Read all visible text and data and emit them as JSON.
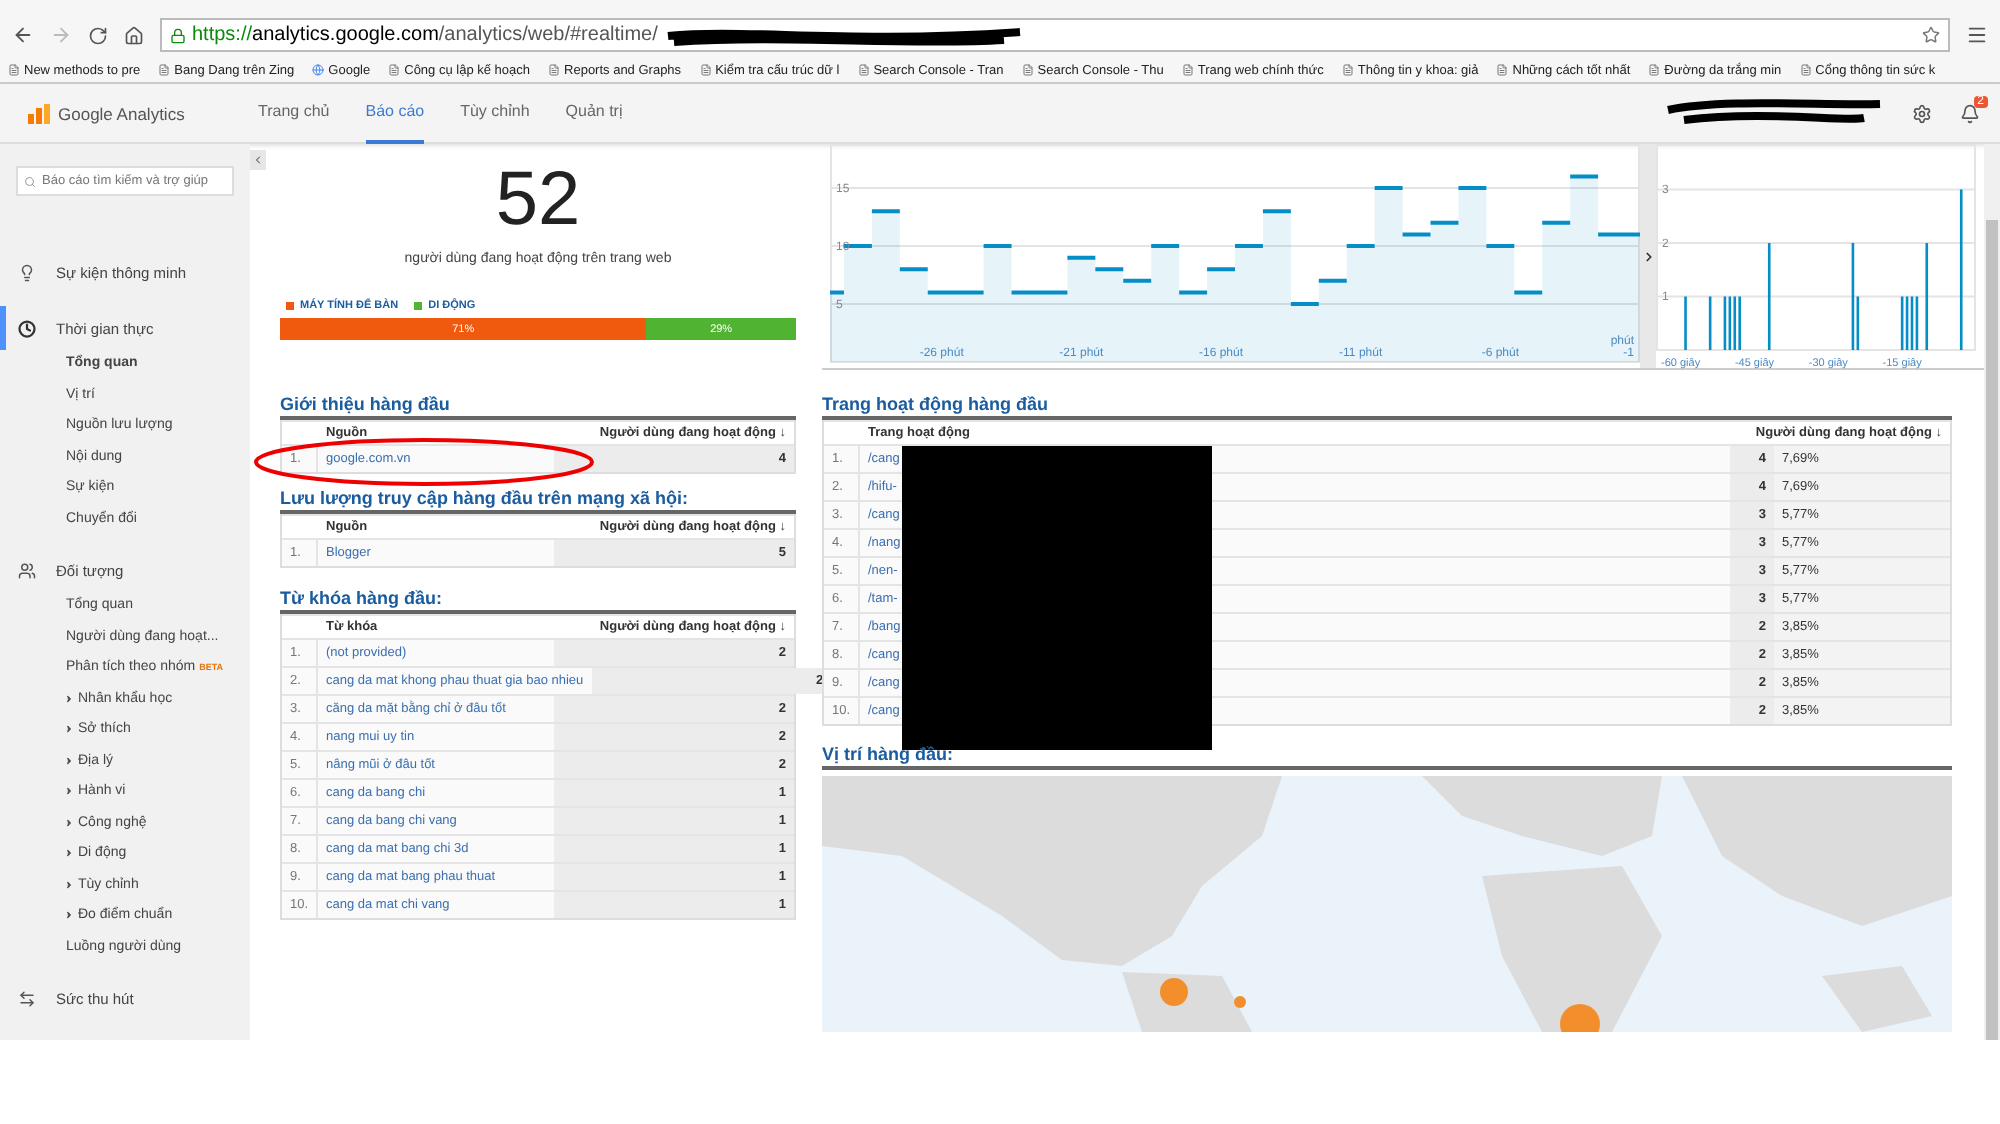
{
  "browser": {
    "url_scheme": "https://",
    "url_host": "analytics.google.com",
    "url_path": "/analytics/web/#realtime/",
    "bookmarks": [
      "New methods to pre",
      "Bang Dang trên Zing",
      "Google",
      "Công cụ lập kế hoạch",
      "Reports and Graphs",
      "Kiểm tra cấu trúc dữ l",
      "Search Console - Tran",
      "Search Console - Thu",
      "Trang web chính thức",
      "Thông tin y khoa: giả",
      "Những cách tốt nhất",
      "Đường da trắng min",
      "Cổng thông tin sức k"
    ]
  },
  "app": {
    "name": "Google Analytics",
    "notifications": "2",
    "nav": [
      {
        "label": "Trang chủ",
        "selected": false
      },
      {
        "label": "Báo cáo",
        "selected": true
      },
      {
        "label": "Tùy chỉnh",
        "selected": false
      },
      {
        "label": "Quản trị",
        "selected": false
      }
    ]
  },
  "sidebar": {
    "search": {
      "placeholder": "Báo cáo tìm kiếm và trợ giúp"
    },
    "sections": [
      {
        "kind": "insights",
        "label": "Sự kiện thông minh",
        "active": false
      },
      {
        "kind": "realtime",
        "label": "Thời gian thực",
        "active": true,
        "children": [
          {
            "label": "Tổng quan",
            "selected": true
          },
          {
            "label": "Vị trí",
            "selected": false
          },
          {
            "label": "Nguồn lưu lượng",
            "selected": false
          },
          {
            "label": "Nội dung",
            "selected": false
          },
          {
            "label": "Sự kiện",
            "selected": false
          },
          {
            "label": "Chuyển đổi",
            "selected": false
          }
        ]
      },
      {
        "kind": "audience",
        "label": "Đối tượng",
        "active": false,
        "children": [
          {
            "label": "Tổng quan",
            "selected": false,
            "expandable": false
          },
          {
            "label": "Người dùng đang hoạt...",
            "selected": false,
            "expandable": false
          },
          {
            "label": "Phân tích theo nhóm",
            "badge": "BETA",
            "selected": false,
            "expandable": false
          },
          {
            "label": "Nhân khẩu học",
            "selected": false,
            "expandable": true
          },
          {
            "label": "Sở thích",
            "selected": false,
            "expandable": true
          },
          {
            "label": "Địa lý",
            "selected": false,
            "expandable": true
          },
          {
            "label": "Hành vi",
            "selected": false,
            "expandable": true
          },
          {
            "label": "Công nghệ",
            "selected": false,
            "expandable": true
          },
          {
            "label": "Di động",
            "selected": false,
            "expandable": true
          },
          {
            "label": "Tùy chỉnh",
            "selected": false,
            "expandable": true
          },
          {
            "label": "Đo điểm chuẩn",
            "selected": false,
            "expandable": true
          },
          {
            "label": "Luồng người dùng",
            "selected": false,
            "expandable": false
          }
        ]
      },
      {
        "kind": "acquisition",
        "label": "Sức thu hút",
        "active": false
      }
    ]
  },
  "overview": {
    "count": "52",
    "caption": "người dùng đang hoạt động trên trang web",
    "devices": [
      {
        "label": "MÁY TÍNH ĐỂ BÀN",
        "share": "71%",
        "level": 0.71,
        "color": "#f05a0e"
      },
      {
        "label": "DI ĐỘNG",
        "share": "29%",
        "level": 0.29,
        "color": "#50b432"
      }
    ]
  },
  "per_minute": {
    "chart_data": {
      "type": "area",
      "x": [
        -30,
        -29,
        -28,
        -27,
        -26,
        -25,
        -24,
        -23,
        -22,
        -21,
        -20,
        -19,
        -18,
        -17,
        -16,
        -15,
        -14,
        -13,
        -12,
        -11,
        -10,
        -9,
        -8,
        -7,
        -6,
        -5,
        -4,
        -3,
        -2,
        -1
      ],
      "series": [
        {
          "color": "#058dc7",
          "values": [
            6,
            10,
            13,
            8,
            6,
            6,
            10,
            6,
            6,
            9,
            8,
            7,
            10,
            6,
            8,
            10,
            13,
            5,
            7,
            10,
            15,
            11,
            12,
            15,
            10,
            6,
            12,
            16,
            11,
            11
          ]
        }
      ],
      "xlim": [
        -30,
        -1
      ],
      "ylim": [
        0,
        18.8
      ],
      "yticks": [
        5,
        10,
        15
      ],
      "grid": true,
      "xticks": [
        {
          "value": -26,
          "label": "-26 phút"
        },
        {
          "value": -21,
          "label": "-21 phút"
        },
        {
          "value": -16,
          "label": "-16 phút"
        },
        {
          "value": -11,
          "label": "-11 phút"
        },
        {
          "value": -6,
          "label": "-6 phút"
        },
        {
          "value": -1,
          "label": "phút -1"
        }
      ]
    }
  },
  "per_second": {
    "chart_data": {
      "type": "bar",
      "x": [
        -60,
        -59,
        -58,
        -57,
        -56,
        -55,
        -54,
        -53,
        -52,
        -51,
        -50,
        -49,
        -48,
        -47,
        -46,
        -45,
        -44,
        -43,
        -42,
        -41,
        -40,
        -39,
        -38,
        -37,
        -36,
        -35,
        -34,
        -33,
        -32,
        -31,
        -30,
        -29,
        -28,
        -27,
        -26,
        -25,
        -24,
        -23,
        -22,
        -21,
        -20,
        -19,
        -18,
        -17,
        -16,
        -15,
        -14,
        -13,
        -12,
        -11,
        -10,
        -9,
        -8,
        -7,
        -6,
        -5,
        -4,
        -3,
        -2,
        -1
      ],
      "series": [
        {
          "color": "#058dc7",
          "values": [
            0,
            1,
            0,
            0,
            0,
            0,
            1,
            0,
            0,
            1,
            1,
            1,
            1,
            0,
            0,
            0,
            0,
            0,
            2,
            0,
            0,
            0,
            0,
            0,
            0,
            0,
            0,
            0,
            0,
            0,
            0,
            0,
            0,
            0,
            0,
            2,
            1,
            0,
            0,
            0,
            0,
            0,
            0,
            0,
            0,
            1,
            1,
            1,
            1,
            0,
            2,
            0,
            0,
            0,
            0,
            0,
            0,
            3,
            0,
            0
          ]
        }
      ],
      "xlim": [
        -65,
        0
      ],
      "ylim": [
        0,
        3.85
      ],
      "yticks": [
        1,
        2,
        3
      ],
      "grid": true,
      "xticks": [
        {
          "value": -60,
          "label": "-60 giây"
        },
        {
          "value": -45,
          "label": "-45 giây"
        },
        {
          "value": -30,
          "label": "-30 giây"
        },
        {
          "value": -15,
          "label": "-15 giây"
        }
      ]
    }
  },
  "referrals": {
    "title": "Giới thiệu hàng đầu",
    "columns": [
      "Nguồn",
      "Người dùng đang hoạt động ↓"
    ],
    "rows": [
      {
        "index": "1.",
        "source": "google.com.vn",
        "users": "4"
      }
    ]
  },
  "social": {
    "title": "Lưu lượng truy cập hàng đầu trên mạng xã hội:",
    "columns": [
      "Nguồn",
      "Người dùng đang hoạt động ↓"
    ],
    "rows": [
      {
        "index": "1.",
        "source": "Blogger",
        "users": "5"
      }
    ]
  },
  "keywords": {
    "title": "Từ khóa hàng đầu:",
    "columns": [
      "Từ khóa",
      "Người dùng đang hoạt động ↓"
    ],
    "rows": [
      {
        "index": "1.",
        "source": "(not provided)",
        "users": "2"
      },
      {
        "index": "2.",
        "source": "cang da mat khong phau thuat gia bao nhieu",
        "users": "2"
      },
      {
        "index": "3.",
        "source": "căng da mặt bằng chỉ ở đâu tốt",
        "users": "2"
      },
      {
        "index": "4.",
        "source": "nang mui uy tin",
        "users": "2"
      },
      {
        "index": "5.",
        "source": "nâng mũi ở đâu tốt",
        "users": "2"
      },
      {
        "index": "6.",
        "source": "cang da bang chi",
        "users": "1"
      },
      {
        "index": "7.",
        "source": "cang da bang chi vang",
        "users": "1"
      },
      {
        "index": "8.",
        "source": "cang da mat bang chi 3d",
        "users": "1"
      },
      {
        "index": "9.",
        "source": "cang da mat bang phau thuat",
        "users": "1"
      },
      {
        "index": "10.",
        "source": "cang da mat chi vang",
        "users": "1"
      }
    ]
  },
  "pages": {
    "title": "Trang hoạt động hàng đầu",
    "columns": [
      "Trang hoạt động",
      "Người dùng đang hoạt động ↓"
    ],
    "rows": [
      {
        "index": "1.",
        "page": "/cang",
        "users": "4",
        "percent": "7,69%"
      },
      {
        "index": "2.",
        "page": "/hifu-",
        "users": "4",
        "percent": "7,69%"
      },
      {
        "index": "3.",
        "page": "/cang",
        "users": "3",
        "percent": "5,77%"
      },
      {
        "index": "4.",
        "page": "/nang",
        "users": "3",
        "percent": "5,77%"
      },
      {
        "index": "5.",
        "page": "/nen-",
        "users": "3",
        "percent": "5,77%"
      },
      {
        "index": "6.",
        "page": "/tam-",
        "users": "3",
        "percent": "5,77%"
      },
      {
        "index": "7.",
        "page": "/bang",
        "users": "2",
        "percent": "3,85%"
      },
      {
        "index": "8.",
        "page": "/cang",
        "users": "2",
        "percent": "3,85%"
      },
      {
        "index": "9.",
        "page": "/cang",
        "users": "2",
        "percent": "3,85%"
      },
      {
        "index": "10.",
        "page": "/cang",
        "users": "2",
        "percent": "3,85%"
      }
    ]
  },
  "locations": {
    "title": "Vị trí hàng đầu:"
  }
}
